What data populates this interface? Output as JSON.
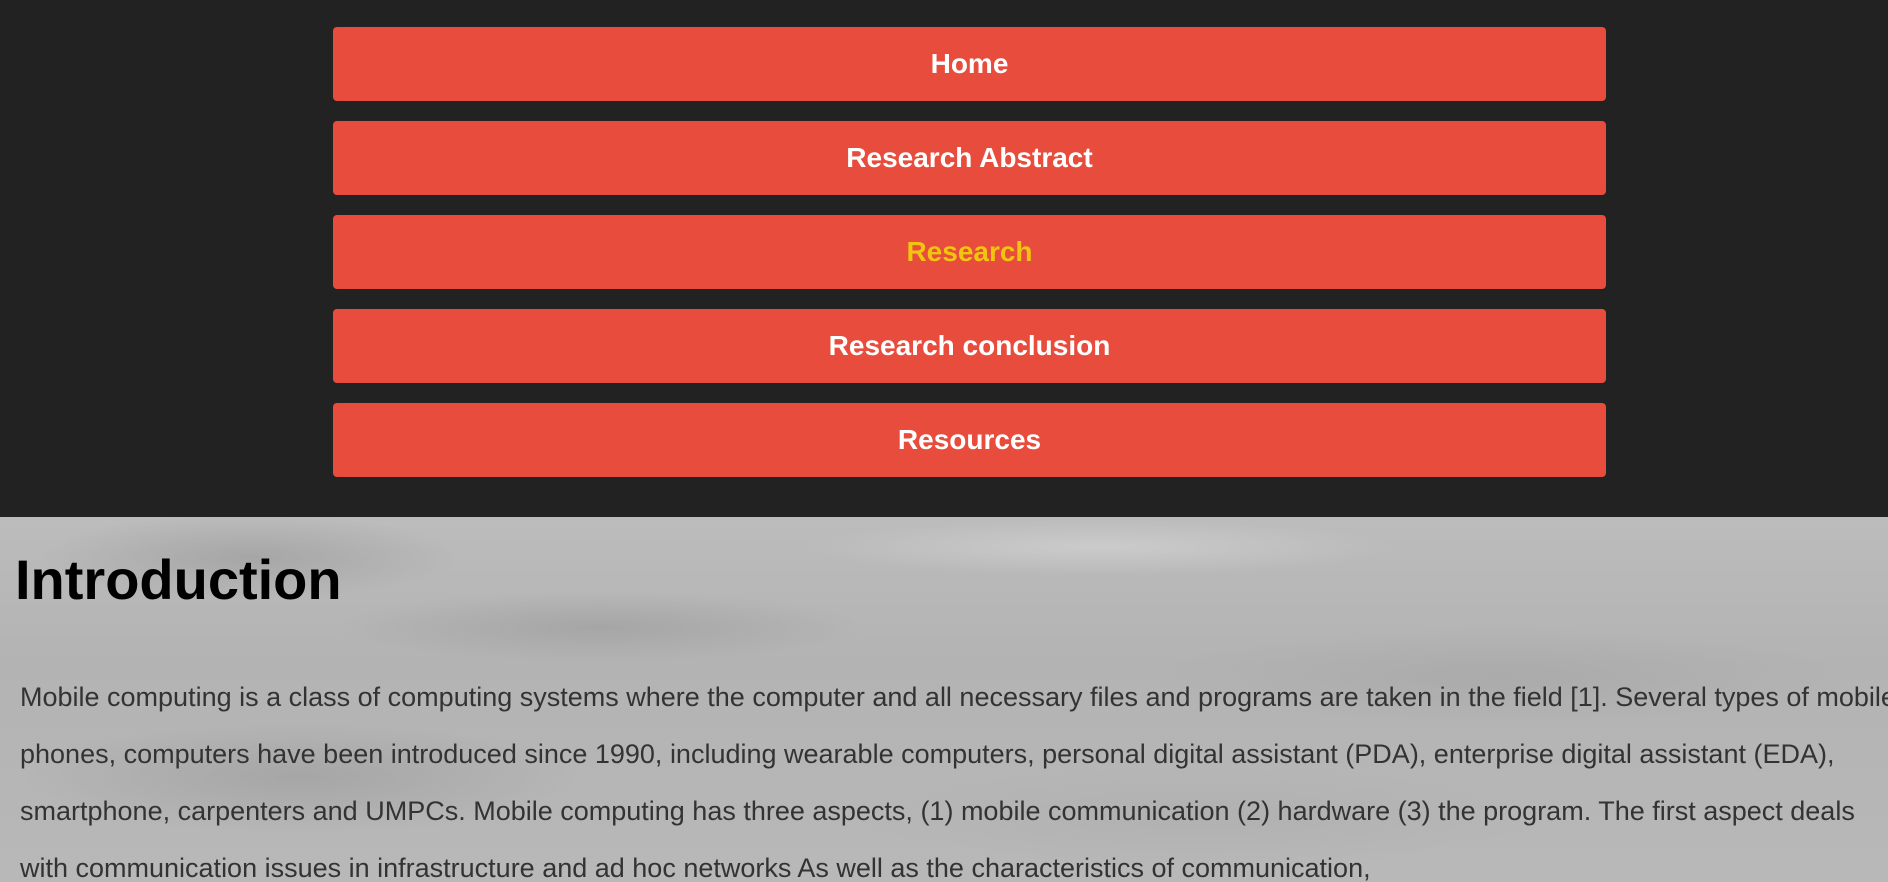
{
  "nav": {
    "items": [
      {
        "label": "Home"
      },
      {
        "label": "Research Abstract"
      },
      {
        "label": "Research"
      },
      {
        "label": "Research conclusion"
      },
      {
        "label": "Resources"
      }
    ],
    "active_index": 2
  },
  "main": {
    "title": "Introduction",
    "paragraph": "Mobile computing is a class of computing systems where the computer and all necessary files and programs are taken in the field [1]. Several types of mobile phones, computers have been introduced since 1990, including wearable computers, personal digital assistant (PDA), enterprise digital assistant (EDA), smartphone, carpenters and UMPCs. Mobile computing has three aspects, (1) mobile communication (2) hardware (3) the program. The first aspect deals with communication issues in infrastructure and ad hoc networks As well as the characteristics of communication,"
  },
  "colors": {
    "header_bg": "#222222",
    "nav_button_bg": "#e74c3c",
    "nav_text": "#ffffff",
    "nav_active_text": "#f1c40f",
    "body_text": "#333333"
  }
}
